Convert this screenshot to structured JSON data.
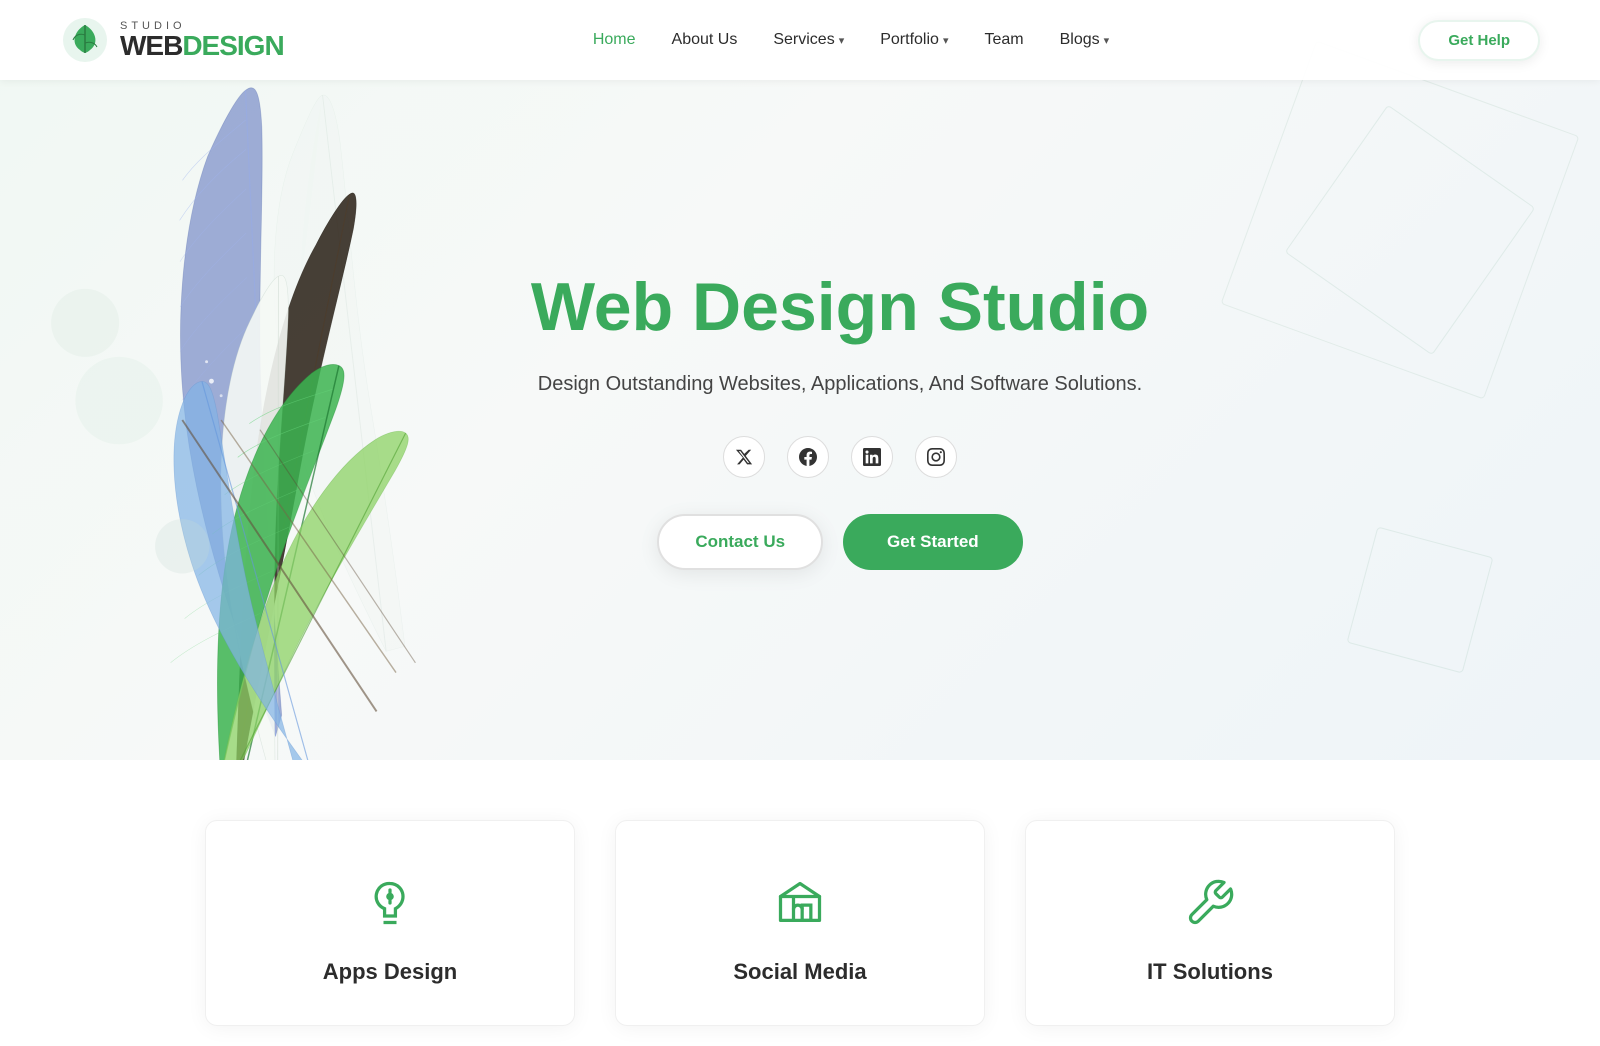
{
  "navbar": {
    "logo": {
      "studio_text": "STUDIO",
      "web_text": "WEB",
      "design_text": "DESIGN"
    },
    "links": [
      {
        "label": "Home",
        "active": true,
        "has_dropdown": false
      },
      {
        "label": "About Us",
        "active": false,
        "has_dropdown": false
      },
      {
        "label": "Services",
        "active": false,
        "has_dropdown": true
      },
      {
        "label": "Portfolio",
        "active": false,
        "has_dropdown": true
      },
      {
        "label": "Team",
        "active": false,
        "has_dropdown": false
      },
      {
        "label": "Blogs",
        "active": false,
        "has_dropdown": true
      }
    ],
    "cta_label": "Get Help"
  },
  "hero": {
    "title": "Web Design Studio",
    "subtitle": "Design Outstanding Websites, Applications, And Software Solutions.",
    "contact_btn": "Contact Us",
    "get_started_btn": "Get Started",
    "social_icons": [
      {
        "name": "twitter",
        "symbol": "𝕏"
      },
      {
        "name": "facebook",
        "symbol": "f"
      },
      {
        "name": "linkedin",
        "symbol": "in"
      },
      {
        "name": "instagram",
        "symbol": "◎"
      }
    ]
  },
  "services": [
    {
      "title": "Apps Design",
      "icon": "lightbulb"
    },
    {
      "title": "Social Media",
      "icon": "megaphone"
    },
    {
      "title": "IT Solutions",
      "icon": "wrench"
    }
  ],
  "colors": {
    "primary_green": "#3aaa5c",
    "text_dark": "#2c2c2c",
    "text_gray": "#555555",
    "bg_light": "#f8f9fa"
  }
}
